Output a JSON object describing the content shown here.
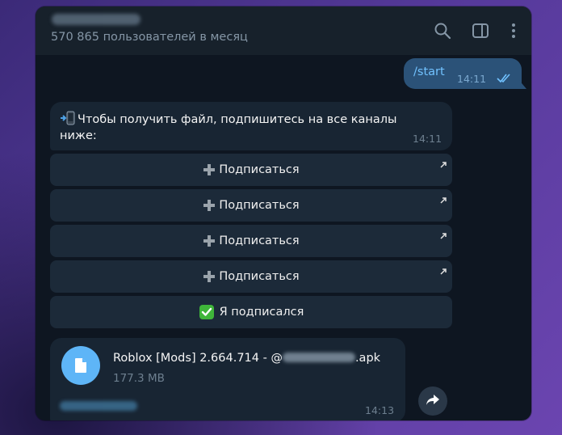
{
  "header": {
    "subtitle": "570 865 пользователей в месяц",
    "icons": [
      "search-icon",
      "sidebar-toggle-icon",
      "more-vertical-icon"
    ]
  },
  "outgoing": {
    "text": "/start",
    "time": "14:11"
  },
  "incoming": {
    "text": "Чтобы получить файл, подпишитесь на все каналы ниже:",
    "time": "14:11"
  },
  "keyboard": {
    "subscribe_label": "Подписаться",
    "buttons": [
      {
        "label": "Подписаться"
      },
      {
        "label": "Подписаться"
      },
      {
        "label": "Подписаться"
      },
      {
        "label": "Подписаться"
      }
    ],
    "confirm_label": "Я подписался"
  },
  "file": {
    "name_prefix": "Roblox [Mods] 2.664.714 - @",
    "name_suffix": ".apk",
    "size": "177.3 MB",
    "time": "14:13"
  },
  "colors": {
    "accent": "#5eb5f7",
    "outgoing_bubble": "#2b5278",
    "incoming_bubble": "#182533",
    "button": "#1c2a39",
    "background": "#0e1621"
  }
}
